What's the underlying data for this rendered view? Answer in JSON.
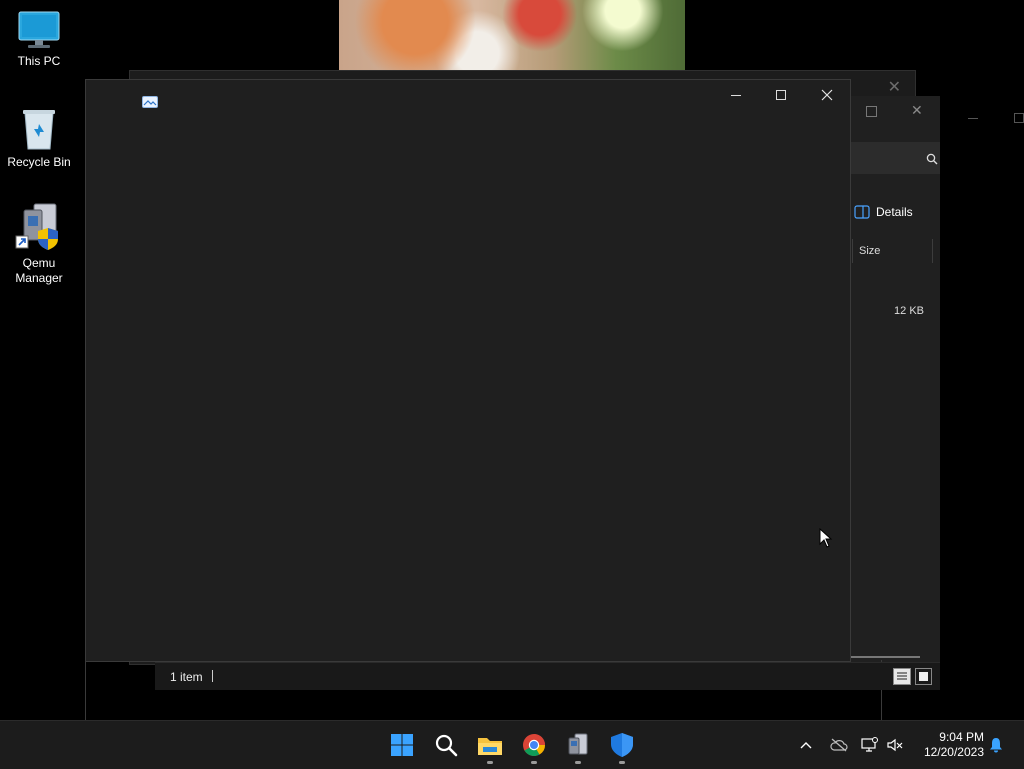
{
  "desktop": {
    "icons": [
      {
        "label": "This PC",
        "icon": "monitor-icon"
      },
      {
        "label": "Recycle Bin",
        "icon": "recycle-bin-icon"
      },
      {
        "label": "Qemu\nManager",
        "icon": "qemu-manager-icon"
      }
    ]
  },
  "explorer_back": {
    "details_label": "Details",
    "column_size": "Size",
    "row_size": "12 KB",
    "status_items": "1 item"
  },
  "taskbar": {
    "apps": [
      "start-icon",
      "search-icon",
      "file-explorer-icon",
      "chrome-icon",
      "qemu-manager-icon",
      "security-icon"
    ],
    "time": "9:04 PM",
    "date": "12/20/2023"
  },
  "colors": {
    "window_bg": "#1f1f1f",
    "taskbar_bg": "#1c1c1c",
    "accent": "#0078d4"
  }
}
